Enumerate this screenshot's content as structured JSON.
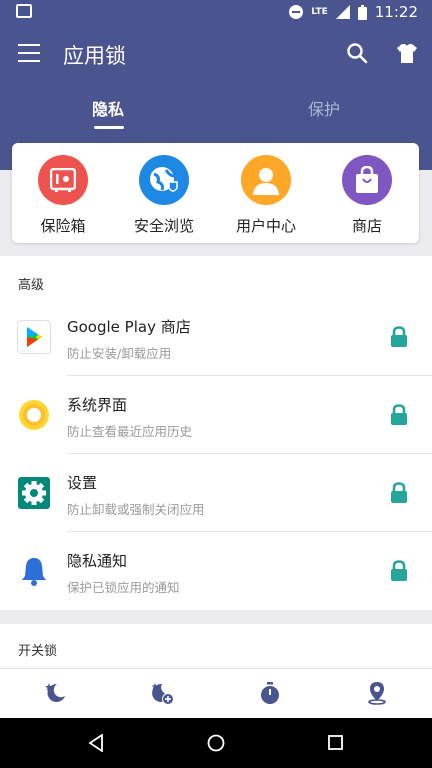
{
  "status_bar": {
    "time": "11:22",
    "network": "LTE"
  },
  "app_bar": {
    "title": "应用锁"
  },
  "tabs": [
    {
      "label": "隐私",
      "active": true
    },
    {
      "label": "保护",
      "active": false
    }
  ],
  "quick_actions": [
    {
      "label": "保险箱",
      "color": "#ef5350"
    },
    {
      "label": "安全浏览",
      "color": "#1e88e5"
    },
    {
      "label": "用户中心",
      "color": "#ffa726"
    },
    {
      "label": "商店",
      "color": "#7e57c2"
    }
  ],
  "advanced": {
    "title": "高级",
    "items": [
      {
        "title": "Google Play 商店",
        "subtitle": "防止安装/卸载应用",
        "locked": true
      },
      {
        "title": "系统界面",
        "subtitle": "防止查看最近应用历史",
        "locked": true
      },
      {
        "title": "设置",
        "subtitle": "防止卸载或强制关闭应用",
        "locked": true
      },
      {
        "title": "隐私通知",
        "subtitle": "保护已锁应用的通知",
        "locked": true
      }
    ]
  },
  "switch_lock": {
    "title": "开关锁"
  },
  "colors": {
    "primary": "#4a548f",
    "lock": "#26a69a",
    "nav_icon": "#4a548f"
  }
}
